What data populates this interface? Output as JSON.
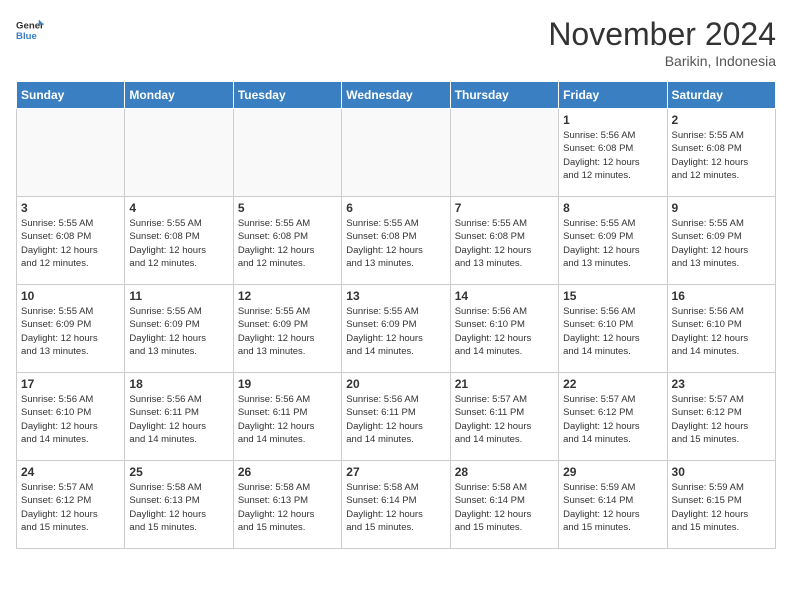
{
  "header": {
    "logo_general": "General",
    "logo_blue": "Blue",
    "month_title": "November 2024",
    "location": "Barikin, Indonesia"
  },
  "weekdays": [
    "Sunday",
    "Monday",
    "Tuesday",
    "Wednesday",
    "Thursday",
    "Friday",
    "Saturday"
  ],
  "weeks": [
    [
      {
        "day": "",
        "info": ""
      },
      {
        "day": "",
        "info": ""
      },
      {
        "day": "",
        "info": ""
      },
      {
        "day": "",
        "info": ""
      },
      {
        "day": "",
        "info": ""
      },
      {
        "day": "1",
        "info": "Sunrise: 5:56 AM\nSunset: 6:08 PM\nDaylight: 12 hours\nand 12 minutes."
      },
      {
        "day": "2",
        "info": "Sunrise: 5:55 AM\nSunset: 6:08 PM\nDaylight: 12 hours\nand 12 minutes."
      }
    ],
    [
      {
        "day": "3",
        "info": "Sunrise: 5:55 AM\nSunset: 6:08 PM\nDaylight: 12 hours\nand 12 minutes."
      },
      {
        "day": "4",
        "info": "Sunrise: 5:55 AM\nSunset: 6:08 PM\nDaylight: 12 hours\nand 12 minutes."
      },
      {
        "day": "5",
        "info": "Sunrise: 5:55 AM\nSunset: 6:08 PM\nDaylight: 12 hours\nand 12 minutes."
      },
      {
        "day": "6",
        "info": "Sunrise: 5:55 AM\nSunset: 6:08 PM\nDaylight: 12 hours\nand 13 minutes."
      },
      {
        "day": "7",
        "info": "Sunrise: 5:55 AM\nSunset: 6:08 PM\nDaylight: 12 hours\nand 13 minutes."
      },
      {
        "day": "8",
        "info": "Sunrise: 5:55 AM\nSunset: 6:09 PM\nDaylight: 12 hours\nand 13 minutes."
      },
      {
        "day": "9",
        "info": "Sunrise: 5:55 AM\nSunset: 6:09 PM\nDaylight: 12 hours\nand 13 minutes."
      }
    ],
    [
      {
        "day": "10",
        "info": "Sunrise: 5:55 AM\nSunset: 6:09 PM\nDaylight: 12 hours\nand 13 minutes."
      },
      {
        "day": "11",
        "info": "Sunrise: 5:55 AM\nSunset: 6:09 PM\nDaylight: 12 hours\nand 13 minutes."
      },
      {
        "day": "12",
        "info": "Sunrise: 5:55 AM\nSunset: 6:09 PM\nDaylight: 12 hours\nand 13 minutes."
      },
      {
        "day": "13",
        "info": "Sunrise: 5:55 AM\nSunset: 6:09 PM\nDaylight: 12 hours\nand 14 minutes."
      },
      {
        "day": "14",
        "info": "Sunrise: 5:56 AM\nSunset: 6:10 PM\nDaylight: 12 hours\nand 14 minutes."
      },
      {
        "day": "15",
        "info": "Sunrise: 5:56 AM\nSunset: 6:10 PM\nDaylight: 12 hours\nand 14 minutes."
      },
      {
        "day": "16",
        "info": "Sunrise: 5:56 AM\nSunset: 6:10 PM\nDaylight: 12 hours\nand 14 minutes."
      }
    ],
    [
      {
        "day": "17",
        "info": "Sunrise: 5:56 AM\nSunset: 6:10 PM\nDaylight: 12 hours\nand 14 minutes."
      },
      {
        "day": "18",
        "info": "Sunrise: 5:56 AM\nSunset: 6:11 PM\nDaylight: 12 hours\nand 14 minutes."
      },
      {
        "day": "19",
        "info": "Sunrise: 5:56 AM\nSunset: 6:11 PM\nDaylight: 12 hours\nand 14 minutes."
      },
      {
        "day": "20",
        "info": "Sunrise: 5:56 AM\nSunset: 6:11 PM\nDaylight: 12 hours\nand 14 minutes."
      },
      {
        "day": "21",
        "info": "Sunrise: 5:57 AM\nSunset: 6:11 PM\nDaylight: 12 hours\nand 14 minutes."
      },
      {
        "day": "22",
        "info": "Sunrise: 5:57 AM\nSunset: 6:12 PM\nDaylight: 12 hours\nand 14 minutes."
      },
      {
        "day": "23",
        "info": "Sunrise: 5:57 AM\nSunset: 6:12 PM\nDaylight: 12 hours\nand 15 minutes."
      }
    ],
    [
      {
        "day": "24",
        "info": "Sunrise: 5:57 AM\nSunset: 6:12 PM\nDaylight: 12 hours\nand 15 minutes."
      },
      {
        "day": "25",
        "info": "Sunrise: 5:58 AM\nSunset: 6:13 PM\nDaylight: 12 hours\nand 15 minutes."
      },
      {
        "day": "26",
        "info": "Sunrise: 5:58 AM\nSunset: 6:13 PM\nDaylight: 12 hours\nand 15 minutes."
      },
      {
        "day": "27",
        "info": "Sunrise: 5:58 AM\nSunset: 6:14 PM\nDaylight: 12 hours\nand 15 minutes."
      },
      {
        "day": "28",
        "info": "Sunrise: 5:58 AM\nSunset: 6:14 PM\nDaylight: 12 hours\nand 15 minutes."
      },
      {
        "day": "29",
        "info": "Sunrise: 5:59 AM\nSunset: 6:14 PM\nDaylight: 12 hours\nand 15 minutes."
      },
      {
        "day": "30",
        "info": "Sunrise: 5:59 AM\nSunset: 6:15 PM\nDaylight: 12 hours\nand 15 minutes."
      }
    ]
  ]
}
